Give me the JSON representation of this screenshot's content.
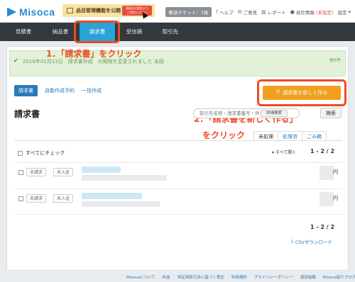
{
  "app": {
    "logo_text": "Misoca"
  },
  "promo": {
    "text": "品目管理機能を公開",
    "badge": "画面右の設定より\nご利用ください"
  },
  "topbar": {
    "ticket": "郵送チケット：1枚",
    "help": "ヘルプ",
    "feedback": "ご意見",
    "report": "レポート",
    "company": "自社情報",
    "company_status": "(未設定)",
    "settings": "設定"
  },
  "nav": {
    "items": [
      {
        "label": "見積書"
      },
      {
        "label": "納品書"
      },
      {
        "label": "請求書"
      },
      {
        "label": "受信箱"
      },
      {
        "label": "取引先"
      }
    ]
  },
  "alert": {
    "text": "2016年01月13日　請求書作成　の期限を変更されました 未読",
    "more": "他5件"
  },
  "annotations": {
    "step1": "1．「請求書」をクリック",
    "step2_line1": "2．「請求書を新しく作る」",
    "step2_line2": "をクリック"
  },
  "subtabs": {
    "invoice": "請求書",
    "auto": "自動作成予約",
    "bulk": "一括作成"
  },
  "new_button": {
    "label": "請求書を新しく作る"
  },
  "page": {
    "title": "請求書"
  },
  "search": {
    "placeholder": "取引先名称・請求書番号・件名",
    "filter": "詳細検索",
    "button": "検索"
  },
  "status_tabs": [
    {
      "label": "未処理"
    },
    {
      "label": "処理済"
    },
    {
      "label": "ごみ箱"
    }
  ],
  "list": {
    "check_all": "すべてにチェック",
    "open_all": "すべて開く",
    "pager": "1 - 2 / 2",
    "rows": [
      {
        "status": "未請求",
        "payment": "未入金",
        "currency": "円"
      },
      {
        "status": "未請求",
        "payment": "未入金",
        "currency": "円"
      }
    ]
  },
  "bottom": {
    "pager": "1 - 2 / 2",
    "csv": "CSVダウンロード"
  },
  "footer": {
    "links": [
      {
        "label": "Misocaについて"
      },
      {
        "label": "料金"
      },
      {
        "label": "特定商取引法に基づく表記"
      },
      {
        "label": "利用規約"
      },
      {
        "label": "プライバシーポリシー"
      },
      {
        "label": "運営組織"
      },
      {
        "label": "Misoca紹介プログラム"
      }
    ]
  },
  "colors": {
    "brand": "#2a8bd0",
    "nav_bg": "#323a40",
    "nav_active": "#2ba3d6",
    "action": "#f0a01e",
    "annotation": "#ee4b22"
  }
}
